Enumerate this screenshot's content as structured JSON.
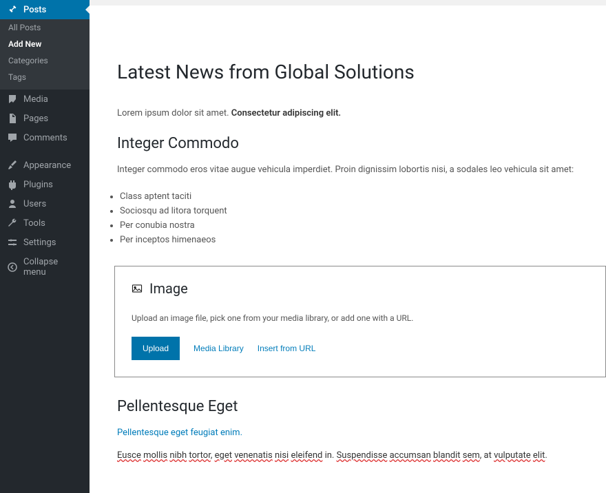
{
  "sidebar": {
    "posts": {
      "label": "Posts",
      "subs": [
        {
          "label": "All Posts"
        },
        {
          "label": "Add New"
        },
        {
          "label": "Categories"
        },
        {
          "label": "Tags"
        }
      ]
    },
    "items": [
      {
        "label": "Media"
      },
      {
        "label": "Pages"
      },
      {
        "label": "Comments"
      },
      {
        "label": "Appearance"
      },
      {
        "label": "Plugins"
      },
      {
        "label": "Users"
      },
      {
        "label": "Tools"
      },
      {
        "label": "Settings"
      }
    ],
    "collapse_label": "Collapse menu"
  },
  "editor": {
    "title": "Latest News from Global Solutions",
    "intro_plain": "Lorem ipsum dolor sit amet. ",
    "intro_bold": "Consectetur adipiscing elit.",
    "h2_integer": "Integer Commodo",
    "integer_para": "Integer commodo eros vitae augue vehicula imperdiet. Proin dignissim lobortis nisi, a sodales leo vehicula sit amet:",
    "list": [
      "Class aptent taciti",
      "Sociosqu ad litora torquent",
      "Per conubia nostra",
      "Per inceptos himenaeos"
    ],
    "image_block": {
      "heading": "Image",
      "desc": "Upload an image file, pick one from your media library, or add one with a URL.",
      "upload_label": "Upload",
      "media_library_label": "Media Library",
      "insert_url_label": "Insert from URL"
    },
    "h2_pellentesque": "Pellentesque Eget",
    "link_para": "Pellentesque eget feugiat enim.",
    "final_para": {
      "w1": "Eusce",
      "w2": "mollis",
      "w3": "nibh",
      "w4": "tortor",
      "sep1": ", ",
      "w5": "eget",
      "w6": "venenatis",
      "w7": "nisi",
      "w8": "eleifend",
      "in": " in. ",
      "w9": "Suspendisse",
      "w10": "accumsan",
      "w11": "blandit",
      "w12": "sem",
      "sep2": ", at ",
      "w13": "vulputate",
      "w14": "elit",
      "dot": "."
    }
  }
}
